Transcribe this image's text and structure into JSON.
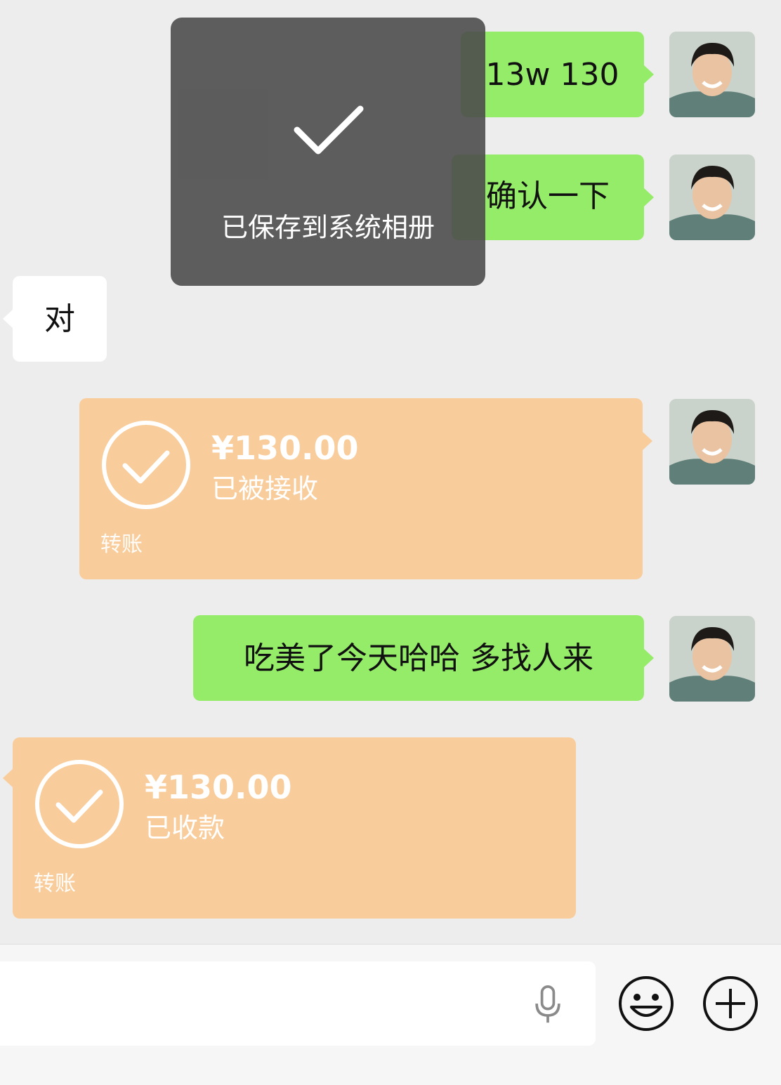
{
  "toast": {
    "icon": "checkmark-icon",
    "text": "已保存到系统相册"
  },
  "messages": {
    "m1": {
      "side": "right",
      "type": "text",
      "text": "13w 130"
    },
    "m2": {
      "side": "right",
      "type": "text",
      "text": "确认一下"
    },
    "m3": {
      "side": "left",
      "type": "text",
      "text": "对"
    },
    "m4": {
      "side": "right",
      "type": "transfer",
      "amount": "¥130.00",
      "status": "已被接收",
      "label": "转账",
      "icon": "check-circle-icon"
    },
    "m5": {
      "side": "right",
      "type": "text",
      "text": "吃美了今天哈哈 多找人来"
    },
    "m6": {
      "side": "left",
      "type": "transfer",
      "amount": "¥130.00",
      "status": "已收款",
      "label": "转账",
      "icon": "check-circle-icon"
    }
  },
  "input_bar": {
    "placeholder": "",
    "voice_icon": "microphone-icon",
    "emoji_icon": "emoji-icon",
    "more_icon": "plus-circle-icon"
  },
  "colors": {
    "background": "#ededed",
    "sent_bubble": "#95ec69",
    "received_bubble": "#ffffff",
    "transfer_bubble": "#f9cd9b",
    "toast_bg": "#4c4c4c"
  }
}
